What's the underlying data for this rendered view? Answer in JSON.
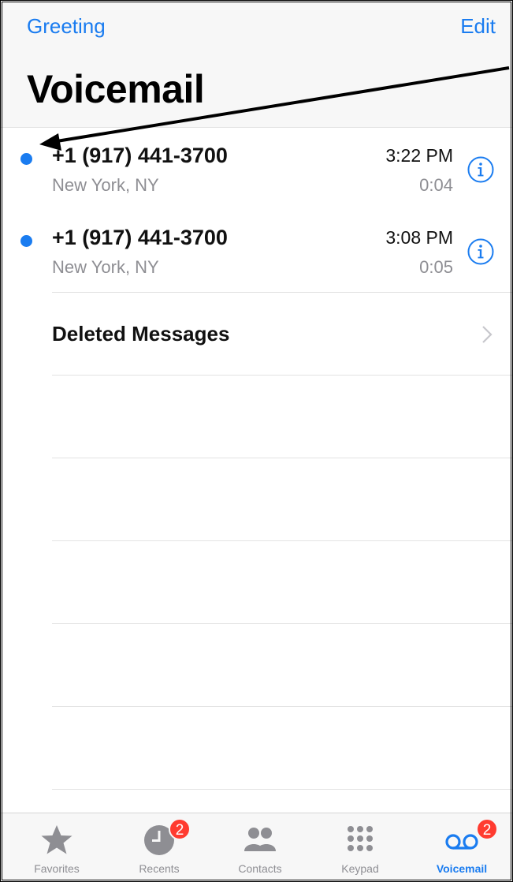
{
  "nav": {
    "left_label": "Greeting",
    "right_label": "Edit"
  },
  "title": "Voicemail",
  "voicemails": [
    {
      "number": "+1 (917) 441-3700",
      "location": "New York, NY",
      "time": "3:22 PM",
      "duration": "0:04",
      "unread": true
    },
    {
      "number": "+1 (917) 441-3700",
      "location": "New York, NY",
      "time": "3:08 PM",
      "duration": "0:05",
      "unread": true
    }
  ],
  "deleted_messages_label": "Deleted Messages",
  "tabs": [
    {
      "label": "Favorites",
      "icon": "star-icon",
      "badge": ""
    },
    {
      "label": "Recents",
      "icon": "clock-icon",
      "badge": "2"
    },
    {
      "label": "Contacts",
      "icon": "contacts-icon",
      "badge": ""
    },
    {
      "label": "Keypad",
      "icon": "keypad-icon",
      "badge": ""
    },
    {
      "label": "Voicemail",
      "icon": "voicemail-icon",
      "badge": "2",
      "active": true
    }
  ],
  "colors": {
    "accent": "#1a7cf0",
    "badge": "#ff3b30",
    "secondary_text": "#8e8e93"
  }
}
